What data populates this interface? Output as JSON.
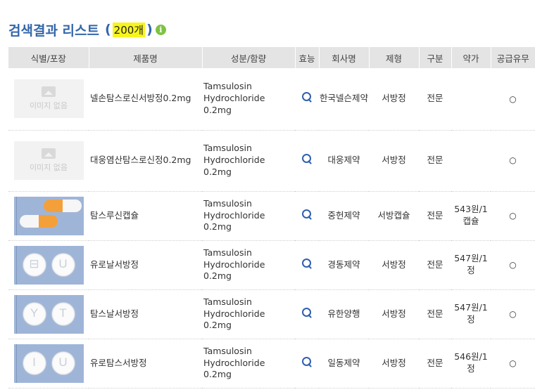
{
  "header": {
    "title": "검색결과 리스트",
    "count_open": "(",
    "count": "200개",
    "count_close": ")",
    "info_glyph": "i"
  },
  "columns": [
    "식별/포장",
    "제품명",
    "성분/함량",
    "효능",
    "회사명",
    "제형",
    "구분",
    "약가",
    "공급유무"
  ],
  "no_image_text": "이미지 없음",
  "rows": [
    {
      "image": "none",
      "name": "넬손탐스로신서방정0.2mg",
      "ingredient_line1": "Tamsulosin",
      "ingredient_line2": "Hydrochloride 0.2mg",
      "company": "한국넬슨제약",
      "form": "서방정",
      "category": "전문",
      "price": "",
      "supply": "○"
    },
    {
      "image": "none",
      "name": "대웅염산탐스로신정0.2mg",
      "ingredient_line1": "Tamsulosin",
      "ingredient_line2": "Hydrochloride 0.2mg",
      "company": "대웅제약",
      "form": "서방정",
      "category": "전문",
      "price": "",
      "supply": "○"
    },
    {
      "image": "capsule",
      "name": "탐스루신캡슐",
      "ingredient_line1": "Tamsulosin",
      "ingredient_line2": "Hydrochloride 0.2mg",
      "company": "중헌제약",
      "form": "서방캡슐",
      "category": "전문",
      "price": "543원/1캡슐",
      "supply": "○"
    },
    {
      "image": "tablet",
      "mark_left": "⊟",
      "mark_right": "U",
      "name": "유로날서방정",
      "ingredient_line1": "Tamsulosin",
      "ingredient_line2": "Hydrochloride 0.2mg",
      "company": "경동제약",
      "form": "서방정",
      "category": "전문",
      "price": "547원/1정",
      "supply": "○"
    },
    {
      "image": "tablet",
      "mark_left": "Y",
      "mark_right": "T",
      "name": "탐스날서방정",
      "ingredient_line1": "Tamsulosin",
      "ingredient_line2": "Hydrochloride 0.2mg",
      "company": "유한양행",
      "form": "서방정",
      "category": "전문",
      "price": "547원/1정",
      "supply": "○"
    },
    {
      "image": "tablet",
      "mark_left": "I",
      "mark_right": "U",
      "name": "유로탐스서방정",
      "ingredient_line1": "Tamsulosin",
      "ingredient_line2": "Hydrochloride 0.2mg",
      "company": "일동제약",
      "form": "서방정",
      "category": "전문",
      "price": "546원/1정",
      "supply": "○"
    }
  ],
  "colors": {
    "title": "#3366aa",
    "highlight": "#f7f51e",
    "info": "#7ec242",
    "header_bg": "#e4e4e4"
  }
}
